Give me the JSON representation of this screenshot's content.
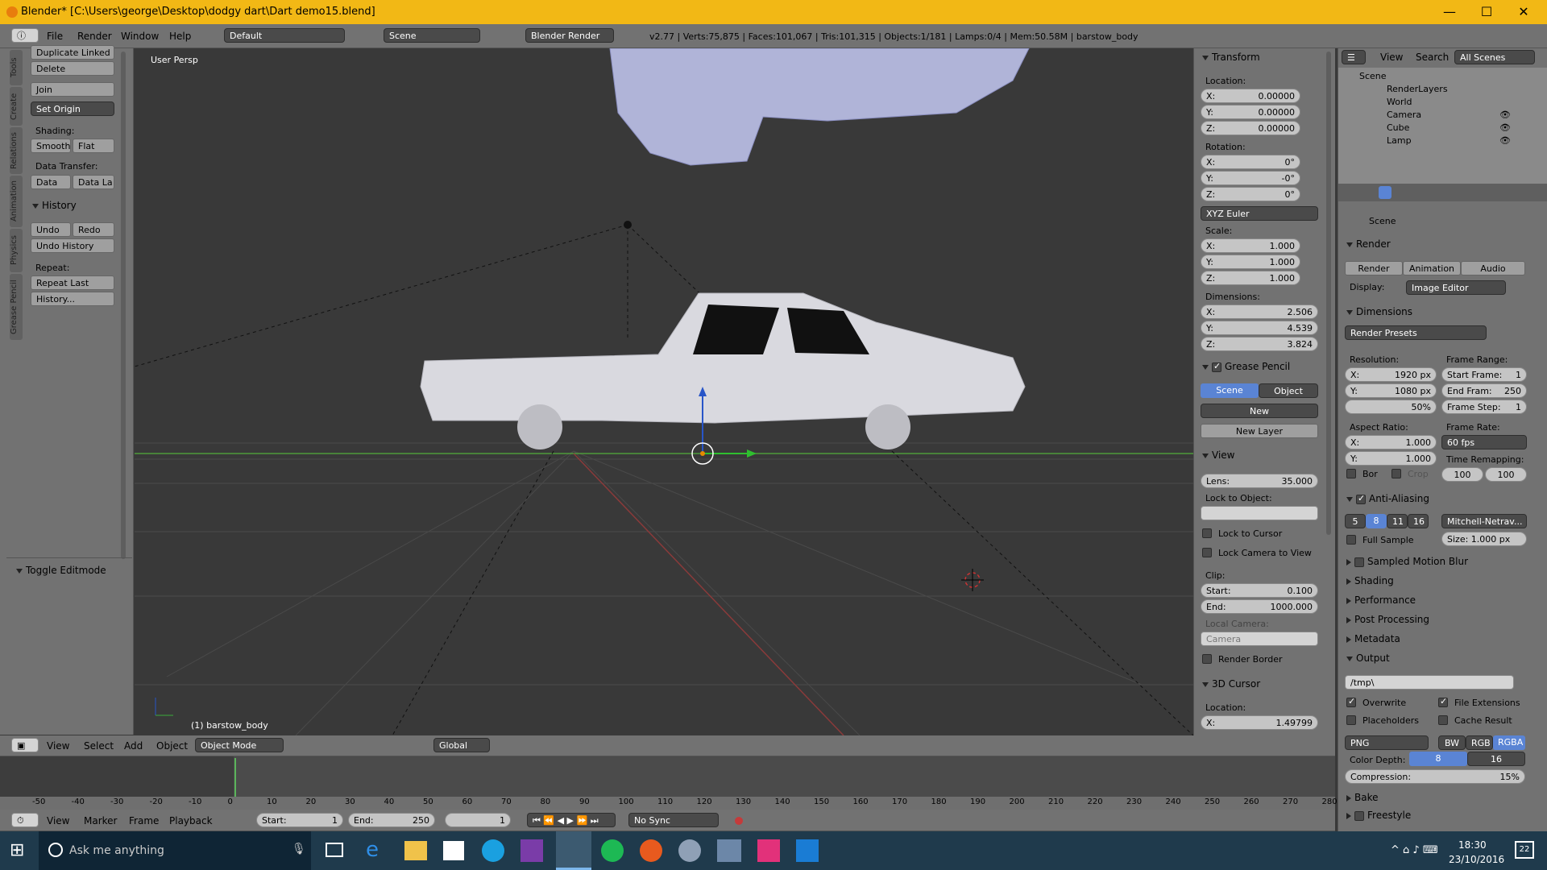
{
  "window": {
    "title": "Blender* [C:\\Users\\george\\Desktop\\dodgy dart\\Dart demo15.blend]",
    "min": "—",
    "max": "☐",
    "close": "✕"
  },
  "topbar": {
    "menus": [
      "File",
      "Render",
      "Window",
      "Help"
    ],
    "layout": "Default",
    "scene": "Scene",
    "engine": "Blender Render",
    "stats": "v2.77 | Verts:75,875 | Faces:101,067 | Tris:101,315 | Objects:1/181 | Lamps:0/4 | Mem:50.58M | barstow_body"
  },
  "toolshelf": {
    "tabs": [
      "Tools",
      "Create",
      "Relations",
      "Animation",
      "Physics",
      "Grease Pencil"
    ],
    "dup_linked": "Duplicate Linked",
    "delete": "Delete",
    "join": "Join",
    "set_origin": "Set Origin",
    "shading_label": "Shading:",
    "smooth": "Smooth",
    "flat": "Flat",
    "data_transfer_label": "Data Transfer:",
    "data": "Data",
    "data_la": "Data La",
    "history_title": "History",
    "undo": "Undo",
    "redo": "Redo",
    "undo_history": "Undo History",
    "repeat_label": "Repeat:",
    "repeat_last": "Repeat Last",
    "history_btn": "History...",
    "toggle_editmode": "Toggle Editmode"
  },
  "viewport": {
    "label": "User Persp",
    "object_label": "(1) barstow_body"
  },
  "npanel": {
    "transform": "Transform",
    "location": "Location:",
    "loc": [
      "X:",
      "0.00000",
      "Y:",
      "0.00000",
      "Z:",
      "0.00000"
    ],
    "rotation": "Rotation:",
    "rot": [
      "X:",
      "0°",
      "Y:",
      "-0°",
      "Z:",
      "0°"
    ],
    "euler": "XYZ Euler",
    "scale": "Scale:",
    "scl": [
      "X:",
      "1.000",
      "Y:",
      "1.000",
      "Z:",
      "1.000"
    ],
    "dimensions": "Dimensions:",
    "dim": [
      "X:",
      "2.506",
      "Y:",
      "4.539",
      "Z:",
      "3.824"
    ],
    "grease": "Grease Pencil",
    "gp_scene": "Scene",
    "gp_object": "Object",
    "gp_new": "New",
    "gp_newlayer": "New Layer",
    "view": "View",
    "lens": "Lens:",
    "lens_val": "35.000",
    "lock_obj": "Lock to Object:",
    "lock_cursor": "Lock to Cursor",
    "lock_cam": "Lock Camera to View",
    "clip": "Clip:",
    "clip_start": "Start:",
    "clip_start_val": "0.100",
    "clip_end": "End:",
    "clip_end_val": "1000.000",
    "local_camera": "Local Camera:",
    "camera": "Camera",
    "render_border": "Render Border",
    "cursor3d": "3D Cursor",
    "cursor_loc": "Location:",
    "cursor_x": "X:",
    "cursor_x_val": "1.49799"
  },
  "outliner": {
    "view": "View",
    "search": "Search",
    "all_scenes": "All Scenes",
    "items": [
      "Scene",
      "RenderLayers",
      "World",
      "Camera",
      "Cube",
      "Lamp"
    ]
  },
  "properties": {
    "scene": "Scene",
    "render": "Render",
    "render_btn": "Render",
    "animation_btn": "Animation",
    "audio_btn": "Audio",
    "display": "Display:",
    "display_val": "Image Editor",
    "dimensions": "Dimensions",
    "presets": "Render Presets",
    "resolution": "Resolution:",
    "res_x": "X:",
    "res_x_val": "1920 px",
    "res_y": "Y:",
    "res_y_val": "1080 px",
    "res_pct": "50%",
    "frame_range": "Frame Range:",
    "start_frame": "Start Frame:",
    "start_frame_val": "1",
    "end_frame": "End Fram:",
    "end_frame_val": "250",
    "frame_step": "Frame Step:",
    "frame_step_val": "1",
    "aspect": "Aspect Ratio:",
    "asp_x": "X:",
    "asp_x_val": "1.000",
    "asp_y": "Y:",
    "asp_y_val": "1.000",
    "frame_rate": "Frame Rate:",
    "fps": "60 fps",
    "time_remap": "Time Remapping:",
    "remap_a": "100",
    "remap_b": "100",
    "bor": "Bor",
    "crop": "Crop",
    "aa": "Anti-Aliasing",
    "aa_samples": [
      "5",
      "8",
      "11",
      "16"
    ],
    "aa_filter": "Mitchell-Netrav...",
    "full_sample": "Full Sample",
    "size": "Size:",
    "size_val": "1.000 px",
    "smb": "Sampled Motion Blur",
    "shading": "Shading",
    "performance": "Performance",
    "post": "Post Processing",
    "metadata": "Metadata",
    "output": "Output",
    "out_path": "/tmp\\",
    "overwrite": "Overwrite",
    "file_ext": "File Extensions",
    "placeholders": "Placeholders",
    "cache": "Cache Result",
    "format": "PNG",
    "bw": "BW",
    "rgb": "RGB",
    "rgba": "RGBA",
    "color_depth": "Color Depth:",
    "cd8": "8",
    "cd16": "16",
    "compression": "Compression:",
    "compression_val": "15%",
    "bake": "Bake",
    "freestyle": "Freestyle"
  },
  "viewheader": {
    "view": "View",
    "select": "Select",
    "add": "Add",
    "object": "Object",
    "mode": "Object Mode",
    "orient": "Global"
  },
  "timeline": {
    "ticks": [
      "-50",
      "-40",
      "-30",
      "-20",
      "-10",
      "0",
      "10",
      "20",
      "30",
      "40",
      "50",
      "60",
      "70",
      "80",
      "90",
      "100",
      "110",
      "120",
      "130",
      "140",
      "150",
      "160",
      "170",
      "180",
      "190",
      "200",
      "210",
      "220",
      "230",
      "240",
      "250",
      "260",
      "270",
      "280"
    ],
    "view": "View",
    "marker": "Marker",
    "frame": "Frame",
    "playback": "Playback",
    "start": "Start:",
    "start_val": "1",
    "end": "End:",
    "end_val": "250",
    "current": "1",
    "sync": "No Sync"
  },
  "taskbar": {
    "search": "Ask me anything",
    "time": "18:30",
    "date": "23/10/2016",
    "notif": "22"
  },
  "colors": {
    "title": "#f2b815",
    "header": "#727272",
    "panel": "#727272",
    "viewport": "#393939",
    "taskbar": "#1f3a4c",
    "accent": "#5a84d4"
  }
}
